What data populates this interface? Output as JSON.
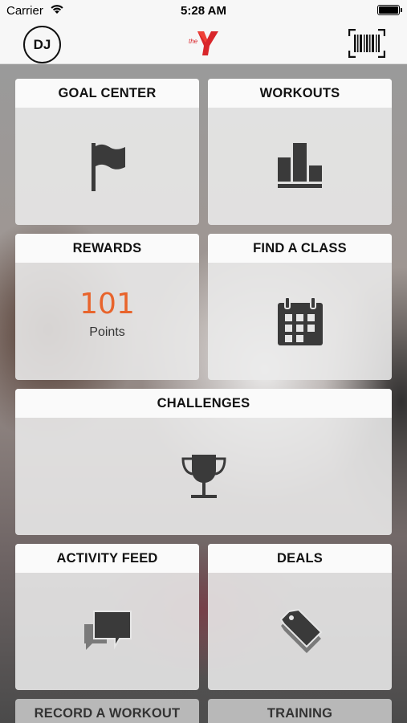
{
  "status_bar": {
    "carrier": "Carrier",
    "time": "5:28 AM"
  },
  "nav": {
    "avatar_initials": "DJ",
    "logo_text": "the",
    "logo_icon": "ymca-logo",
    "barcode_icon": "barcode-scan-icon"
  },
  "tiles": {
    "goal_center": {
      "title": "GOAL CENTER",
      "icon": "flag-icon"
    },
    "workouts": {
      "title": "WORKOUTS",
      "icon": "bar-chart-icon"
    },
    "rewards": {
      "title": "REWARDS",
      "points": "101",
      "points_label": "Points"
    },
    "find_a_class": {
      "title": "FIND A CLASS",
      "icon": "calendar-icon"
    },
    "challenges": {
      "title": "CHALLENGES",
      "icon": "trophy-icon"
    },
    "activity_feed": {
      "title": "ACTIVITY FEED",
      "icon": "chat-bubbles-icon"
    },
    "deals": {
      "title": "DEALS",
      "icon": "price-tag-icon"
    },
    "record_a_workout": {
      "title": "RECORD A WORKOUT"
    },
    "training": {
      "title": "TRAINING"
    }
  },
  "colors": {
    "accent": "#e8642c",
    "logo_red": "#d9262b",
    "icon_dark": "#3a3a3a"
  }
}
